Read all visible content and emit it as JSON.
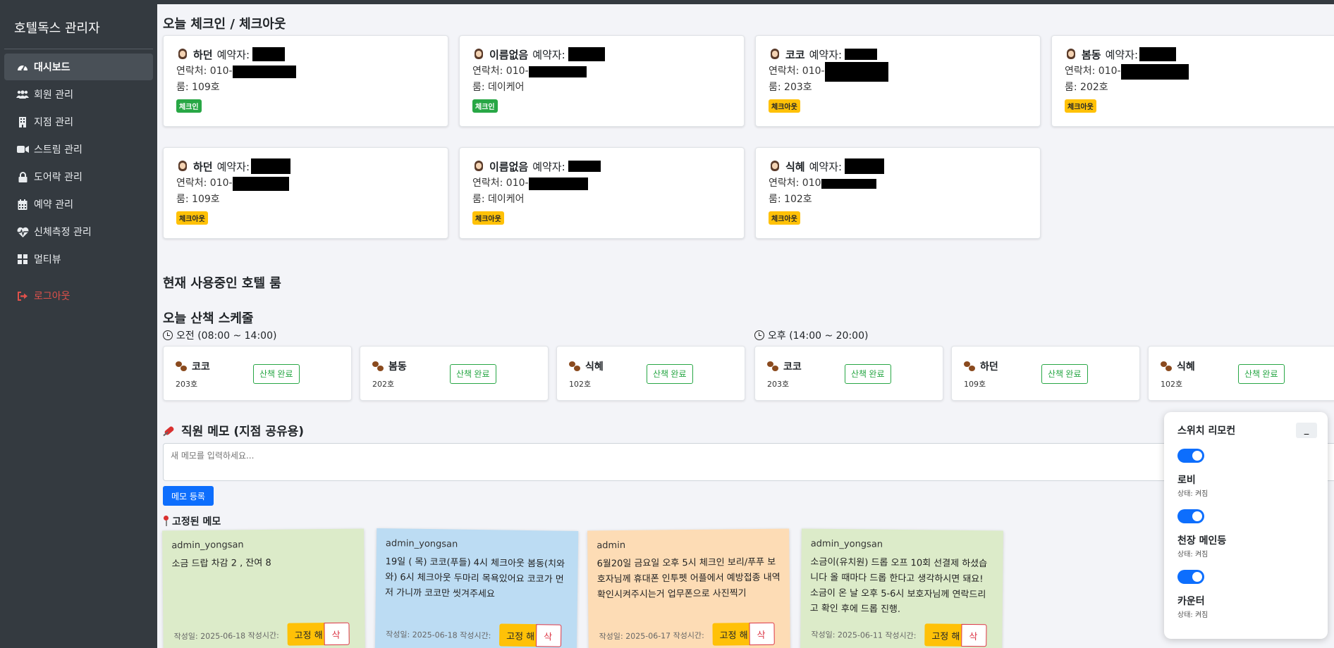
{
  "app": {
    "title": "호텔독스 관리자"
  },
  "sidebar": {
    "items": [
      {
        "label": "대시보드",
        "icon": "dashboard-icon",
        "active": true
      },
      {
        "label": "회원 관리",
        "icon": "users-icon"
      },
      {
        "label": "지점 관리",
        "icon": "building-icon"
      },
      {
        "label": "스트림 관리",
        "icon": "video-icon"
      },
      {
        "label": "도어락 관리",
        "icon": "lock-icon"
      },
      {
        "label": "예약 관리",
        "icon": "calendar-icon"
      },
      {
        "label": "신체측정 관리",
        "icon": "heartbeat-icon"
      },
      {
        "label": "멀티뷰",
        "icon": "grid-icon"
      }
    ],
    "logout": {
      "label": "로그아웃",
      "icon": "sign-out-icon"
    }
  },
  "checkin": {
    "title": "오늘 체크인 / 체크아웃",
    "cards": [
      {
        "pet": "하던",
        "booker_label": "예약자:",
        "contact": "연락처: 010-",
        "room": "룸: 109호",
        "status": "체크인",
        "status_type": "in"
      },
      {
        "pet": "이름없음",
        "booker_label": "예약자:",
        "contact": "연락처: 010-",
        "room": "룸: 데이케어",
        "status": "체크인",
        "status_type": "in"
      },
      {
        "pet": "코코",
        "booker_label": "예약자:",
        "contact": "연락처: 010-",
        "room": "룸: 203호",
        "status": "체크아웃",
        "status_type": "out"
      },
      {
        "pet": "봄동",
        "booker_label": "예약자:",
        "contact": "연락처: 010-",
        "room": "룸: 202호",
        "status": "체크아웃",
        "status_type": "out"
      },
      {
        "pet": "하던",
        "booker_label": "예약자:",
        "contact": "연락처: 010-",
        "room": "룸: 109호",
        "status": "체크아웃",
        "status_type": "out"
      },
      {
        "pet": "이름없음",
        "booker_label": "예약자:",
        "contact": "연락처: 010-",
        "room": "룸: 데이케어",
        "status": "체크아웃",
        "status_type": "out"
      },
      {
        "pet": "식혜",
        "booker_label": "예약자:",
        "contact": "연락처: 010",
        "room": "룸: 102호",
        "status": "체크아웃",
        "status_type": "out"
      }
    ]
  },
  "rooms": {
    "title": "현재 사용중인 호텔 룸"
  },
  "walks": {
    "title": "오늘 산책 스케줄",
    "morning": {
      "label": "오전 (08:00 ~ 14:00)",
      "items": [
        {
          "name": "코코",
          "room": "203호",
          "button": "산책 완료"
        },
        {
          "name": "봄동",
          "room": "202호",
          "button": "산책 완료"
        },
        {
          "name": "식혜",
          "room": "102호",
          "button": "산책 완료"
        }
      ]
    },
    "afternoon": {
      "label": "오후 (14:00 ~ 20:00)",
      "items": [
        {
          "name": "코코",
          "room": "203호",
          "button": "산책 완료"
        },
        {
          "name": "하던",
          "room": "109호",
          "button": "산책 완료"
        },
        {
          "name": "식혜",
          "room": "102호",
          "button": "산책 완료"
        }
      ]
    }
  },
  "memo": {
    "title": "직원 메모 (지점 공유용)",
    "placeholder": "새 메모를 입력하세요...",
    "submit": "메모 등록",
    "pinned_title": "고정된 메모",
    "notes": [
      {
        "author": "admin_yongsan",
        "content": "소금 드랍 차감 2 , 잔여 8",
        "meta": "작성일: 2025-06-18 작성시간:",
        "unpin": "고정 해",
        "delete": "삭",
        "color": "green"
      },
      {
        "author": "admin_yongsan",
        "content": "19일 ( 목) 코코(푸들) 4시 체크아웃 봄동(치와와) 6시 체크아웃 두마리 목욕있어요 코코가 먼저 가니까 코코만 씻겨주세요",
        "meta": "작성일: 2025-06-18 작성시간:",
        "unpin": "고정 해",
        "delete": "삭",
        "color": "blue"
      },
      {
        "author": "admin",
        "content": "6월20일 금요일 오후 5시 체크인 보리/푸푸 보호자님께 휴대폰 인투펫 어플에서 예방접종 내역 확인시켜주시는거 업무폰으로 사진찍기",
        "meta": "작성일: 2025-06-17 작성시간:",
        "unpin": "고정 해",
        "delete": "삭",
        "color": "orange"
      },
      {
        "author": "admin_yongsan",
        "content": "소금이(유치원) 드롭 오프 10회 선결제 하셨습니다 올 때마다 드롭 한다고 생각하시면 돼요! 소금이 온 날 오후 5-6시 보호자님께 연락드리고 확인 후에 드롭 진행.",
        "meta": "작성일: 2025-06-11 작성시간:",
        "unpin": "고정 해",
        "delete": "삭",
        "color": "green"
      }
    ]
  },
  "remote": {
    "title": "스위치 리모컨",
    "minimize": "_",
    "switches": [
      {
        "name": "로비",
        "state": "상태: 켜짐",
        "on": true
      },
      {
        "name": "천장 메인등",
        "state": "상태: 켜짐",
        "on": true
      },
      {
        "name": "카운터",
        "state": "상태: 켜짐",
        "on": true
      }
    ]
  },
  "colors": {
    "sidebar": "#343a40",
    "primary": "#0d6efd",
    "success": "#28a745",
    "warning": "#ffc107",
    "danger": "#dc3545"
  }
}
